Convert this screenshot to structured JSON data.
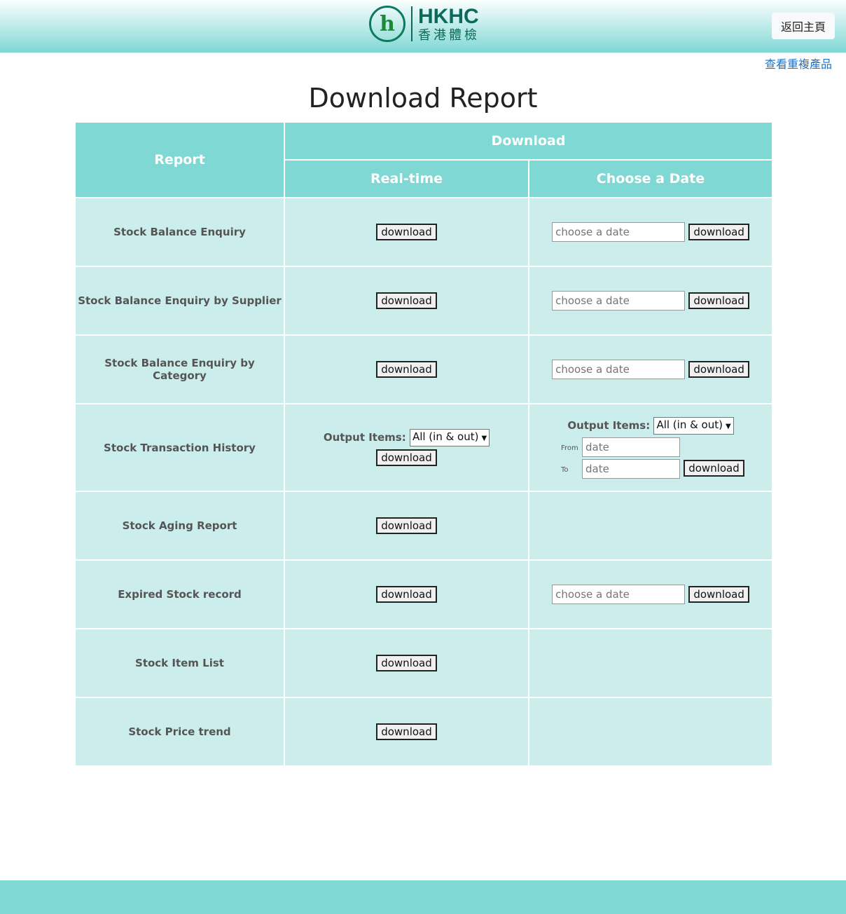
{
  "header": {
    "logo_en": "HKHC",
    "logo_zh": "香港體檢",
    "home_button": "返回主頁",
    "duplicate_link": "查看重複產品"
  },
  "title": "Download Report",
  "table": {
    "col_report": "Report",
    "col_download": "Download",
    "col_realtime": "Real-time",
    "col_date": "Choose a Date"
  },
  "labels": {
    "download": "download",
    "date_placeholder": "choose a date",
    "output_items": "Output Items:",
    "output_option": "All (in & out)",
    "from": "From",
    "to": "To",
    "date_short": "date"
  },
  "rows": [
    {
      "name": "Stock Balance Enquiry",
      "realtime": "download",
      "dated": "single"
    },
    {
      "name": "Stock Balance Enquiry by Supplier",
      "realtime": "download",
      "dated": "single"
    },
    {
      "name": "Stock Balance Enquiry by Category",
      "realtime": "download",
      "dated": "single"
    },
    {
      "name": "Stock Transaction History",
      "realtime": "output",
      "dated": "range"
    },
    {
      "name": "Stock Aging Report",
      "realtime": "download",
      "dated": "none"
    },
    {
      "name": "Expired Stock record",
      "realtime": "download",
      "dated": "single"
    },
    {
      "name": "Stock Item List",
      "realtime": "download",
      "dated": "none"
    },
    {
      "name": "Stock Price trend",
      "realtime": "download",
      "dated": "none"
    }
  ]
}
